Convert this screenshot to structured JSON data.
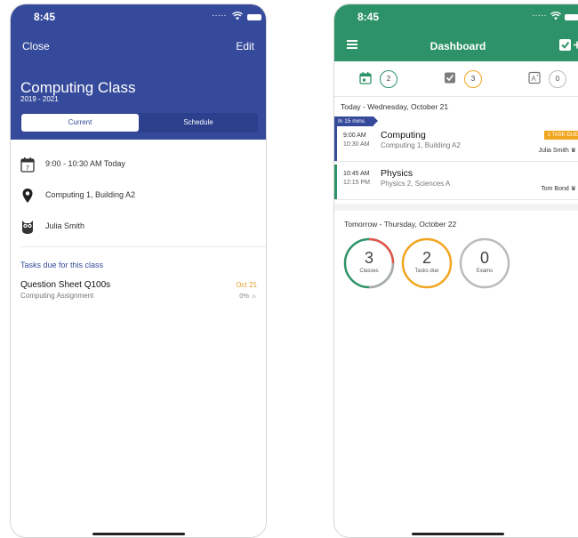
{
  "status": {
    "time_left": "8:45",
    "time_right": "8:45",
    "signal": "....."
  },
  "class_screen": {
    "close_label": "Close",
    "edit_label": "Edit",
    "title": "Computing Class",
    "years": "2019 - 2021",
    "tabs": [
      {
        "label": "Current"
      },
      {
        "label": "Schedule"
      }
    ],
    "time_row": "9:00 - 10:30 AM Today",
    "location_row": "Computing 1, Building A2",
    "teacher_row": "Julia Smith",
    "calendar_day": "7",
    "tasks_header": "Tasks due for this class",
    "task": {
      "name": "Question Sheet Q100s",
      "type": "Computing Assignment",
      "due": "Oct 21",
      "progress": "0%"
    },
    "colors": {
      "header": "#354a9b"
    }
  },
  "dashboard": {
    "title": "Dashboard",
    "summary": [
      {
        "icon": "calendar-icon",
        "count": "2",
        "color": "#2e9268"
      },
      {
        "icon": "checkbox-icon",
        "count": "3",
        "color": "#f2a51e"
      },
      {
        "icon": "exam-icon",
        "count": "0",
        "color": "#bbbbbb"
      }
    ],
    "today_label": "Today - Wednesday, October 21",
    "soon_label": "In 15 mins",
    "classes": [
      {
        "start": "9:00 AM",
        "end": "10:30 AM",
        "subject": "Computing",
        "location": "Computing 1, Building A2",
        "teacher": "Julia Smith",
        "badge": "1 TASK DUE",
        "color": "#354a9b"
      },
      {
        "start": "10:45 AM",
        "end": "12:15 PM",
        "subject": "Physics",
        "location": "Physics 2, Sciences A",
        "teacher": "Tom Bond",
        "color": "#2e9268"
      }
    ],
    "tomorrow_label": "Tomorrow - Thursday, October 22",
    "rings": [
      {
        "value": "3",
        "label": "Classes"
      },
      {
        "value": "2",
        "label": "Tasks due"
      },
      {
        "value": "0",
        "label": "Exams"
      }
    ],
    "colors": {
      "header": "#2e9268",
      "accent": "#f2a51e",
      "danger": "#e5534b"
    }
  }
}
